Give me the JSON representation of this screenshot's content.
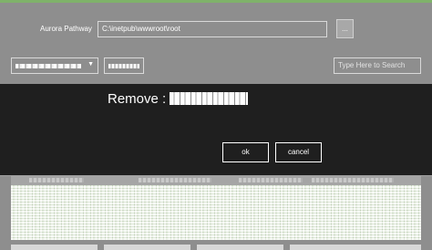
{
  "path": {
    "label": "Aurora Pathway",
    "value": "C:\\inetpub\\wwwroot\\root",
    "browse_label": "..."
  },
  "search": {
    "placeholder": "Type Here to Search"
  },
  "modal": {
    "message": "Remove :",
    "ok_label": "ok",
    "cancel_label": "cancel"
  },
  "colors": {
    "overlay_background": "#8e8e8e",
    "dialog_background": "#1f1f1f",
    "accent_line": "#7fb26a"
  },
  "icons": {
    "dropdown": "chevron-down-icon"
  }
}
